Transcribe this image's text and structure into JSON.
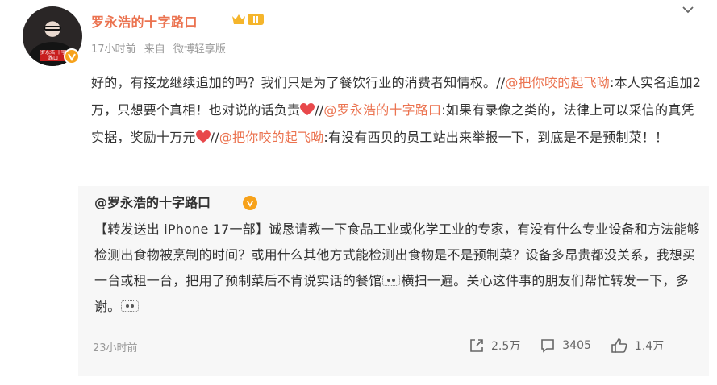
{
  "post": {
    "author": "罗永浩的十字路口",
    "meta": {
      "time": "17小时前",
      "source_prefix": "来自",
      "source": "微博轻享版"
    },
    "avatar_tag": "罗永浩 十字路口",
    "content": {
      "p1": "好的，有接龙继续追加的吗？我们只是为了餐饮行业的消费者知情权。//",
      "m1": "@把你咬的起飞呦",
      "p2": ":本人实名追加2万，只想要个真相！也对说的话负责",
      "p3": "//",
      "m2": "@罗永浩的十字路口",
      "p4": ":如果有录像之类的，法律上可以采信的真凭实据，奖励十万元",
      "p5": "//",
      "m3": "@把你咬的起飞呦",
      "p6": ":有没有西贝的员工站出来举报一下，到底是不是预制菜！！"
    }
  },
  "repost": {
    "author": "@罗永浩的十字路口",
    "text": {
      "t1": "【转发送出 iPhone 17一部】诚恳请教一下食品工业或化学工业的专家，有没有什么专业设备和方法能够检测出食物被烹制的时间？或用什么其他方式能检测出食物是不是预制菜？设备多昂贵都没关系，我想买一台或租一台，把用了预制菜后不肯说实话的餐馆",
      "t2": "横扫一遍。关心这件事的朋友们帮忙转发一下，多谢。"
    },
    "time": "23小时前",
    "actions": {
      "share": "2.5万",
      "comments": "3405",
      "likes": "1.4万"
    }
  },
  "colors": {
    "accent": "#eb7350",
    "verified": "#f7a21b",
    "heart": "#e8484b",
    "repost_bg": "#f7f7f7"
  },
  "icons": [
    "verified-badge-icon",
    "crown-level-badge-icon",
    "chevron-down-icon",
    "heart-icon",
    "doge-emoticon-icon",
    "share-icon",
    "comment-icon",
    "like-icon"
  ]
}
